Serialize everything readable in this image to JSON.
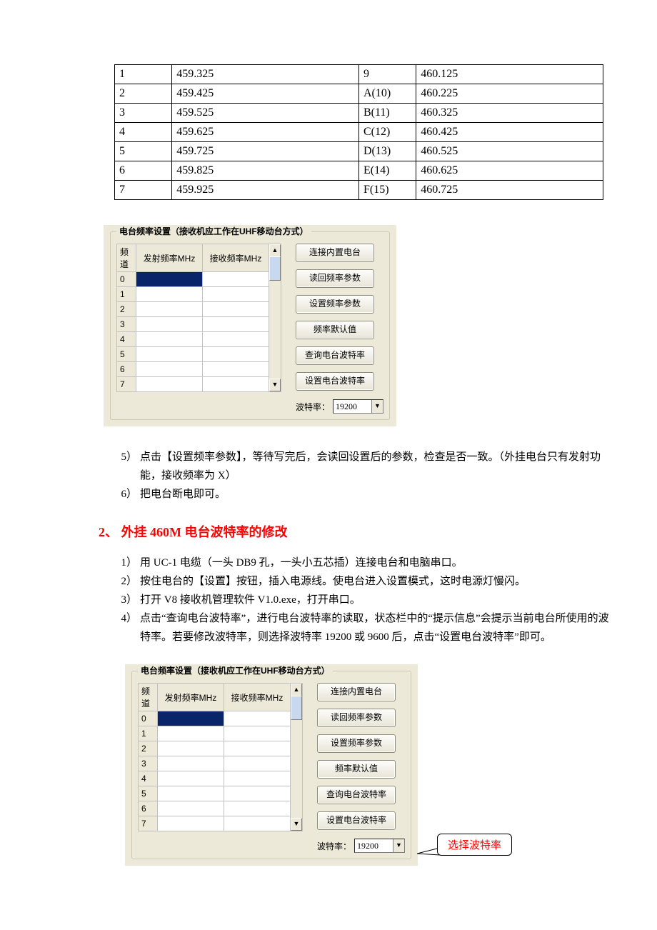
{
  "freq_table": {
    "rows": [
      {
        "a": "1",
        "af": "459.325",
        "b": "9",
        "bf": "460.125"
      },
      {
        "a": "2",
        "af": "459.425",
        "b": "A(10)",
        "bf": "460.225"
      },
      {
        "a": "3",
        "af": "459.525",
        "b": "B(11)",
        "bf": "460.325"
      },
      {
        "a": "4",
        "af": "459.625",
        "b": "C(12)",
        "bf": "460.425"
      },
      {
        "a": "5",
        "af": "459.725",
        "b": "D(13)",
        "bf": "460.525"
      },
      {
        "a": "6",
        "af": "459.825",
        "b": "E(14)",
        "bf": "460.625"
      },
      {
        "a": "7",
        "af": "459.925",
        "b": "F(15)",
        "bf": "460.725"
      }
    ]
  },
  "panel": {
    "legend": "电台频率设置（接收机应工作在UHF移动台方式）",
    "grid": {
      "col_ch": "频道",
      "col_tx": "发射频率MHz",
      "col_rx": "接收频率MHz",
      "rows": [
        "0",
        "1",
        "2",
        "3",
        "4",
        "5",
        "6",
        "7"
      ]
    },
    "buttons": {
      "connect": "连接内置电台",
      "read": "读回频率参数",
      "set_freq": "设置频率参数",
      "default": "频率默认值",
      "query_baud": "查询电台波特率",
      "set_baud": "设置电台波特率"
    },
    "baud_label": "波特率：",
    "baud_value": "19200"
  },
  "text": {
    "step5_no": "5）",
    "step5": "点击【设置频率参数】，等待写完后，会读回设置后的参数，检查是否一致。（外挂电台只有发射功能，接收频率为 X）",
    "step6_no": "6）",
    "step6": "把电台断电即可。",
    "section2_no": "2、",
    "section2_title": "外挂 460M 电台波特率的修改",
    "b1_no": "1）",
    "b1": "用 UC-1 电缆（一头 DB9 孔，一头小五芯插）连接电台和电脑串口。",
    "b2_no": "2）",
    "b2": "按住电台的【设置】按钮，插入电源线。使电台进入设置模式，这时电源灯慢闪。",
    "b3_no": "3）",
    "b3": "打开 V8 接收机管理软件 V1.0.exe，打开串口。",
    "b4_no": "4）",
    "b4": "点击“查询电台波特率”，进行电台波特率的读取，状态栏中的“提示信息”会提示当前电台所使用的波特率。若要修改波特率，则选择波特率 19200 或 9600 后，点击“设置电台波特率”即可。",
    "callout": "选择波特率"
  }
}
